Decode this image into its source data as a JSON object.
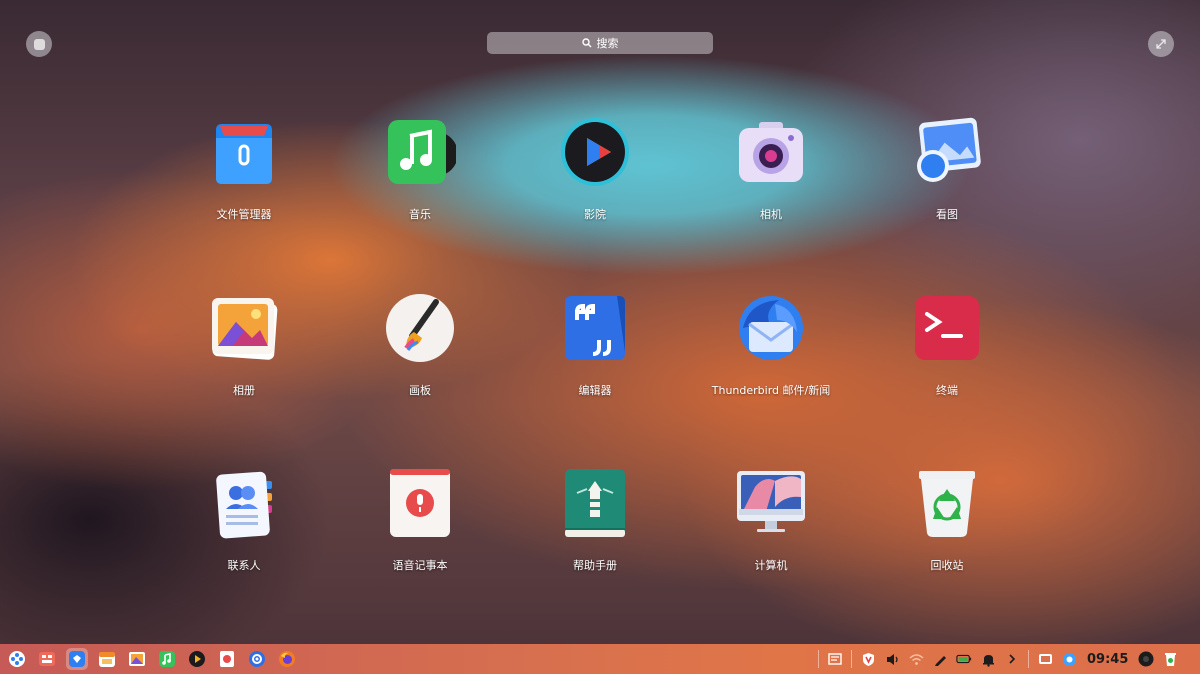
{
  "search": {
    "label": "搜索"
  },
  "apps": [
    {
      "name": "文件管理器",
      "icon": "folder-icon"
    },
    {
      "name": "音乐",
      "icon": "music-icon"
    },
    {
      "name": "影院",
      "icon": "movie-icon"
    },
    {
      "name": "相机",
      "icon": "camera-icon"
    },
    {
      "name": "看图",
      "icon": "image-viewer-icon"
    },
    {
      "name": "相册",
      "icon": "album-icon"
    },
    {
      "name": "画板",
      "icon": "draw-icon"
    },
    {
      "name": "编辑器",
      "icon": "text-editor-icon"
    },
    {
      "name": "Thunderbird 邮件/新闻",
      "icon": "thunderbird-icon"
    },
    {
      "name": "终端",
      "icon": "terminal-icon"
    },
    {
      "name": "联系人",
      "icon": "contacts-icon"
    },
    {
      "name": "语音记事本",
      "icon": "voice-note-icon"
    },
    {
      "name": "帮助手册",
      "icon": "manual-icon"
    },
    {
      "name": "计算机",
      "icon": "computer-icon"
    },
    {
      "name": "回收站",
      "icon": "trash-icon"
    }
  ],
  "taskbar": {
    "clock": "09:45",
    "left_icons": [
      "launcher-icon",
      "multitask-icon",
      "app-store-icon",
      "calendar-icon",
      "album-icon",
      "music-icon",
      "movie-icon",
      "voice-note-icon",
      "settings-icon",
      "firefox-icon"
    ],
    "tray_icons": [
      "notes-icon",
      "antivirus-icon",
      "volume-icon",
      "wifi-icon",
      "pen-icon",
      "battery-icon",
      "notification-icon",
      "chevron-right-icon",
      "screen-icon",
      "browser-icon",
      "power-icon",
      "trash-icon"
    ]
  },
  "colors": {
    "taskbar": "#d7704f",
    "accent_blue": "#2f7ff0"
  }
}
